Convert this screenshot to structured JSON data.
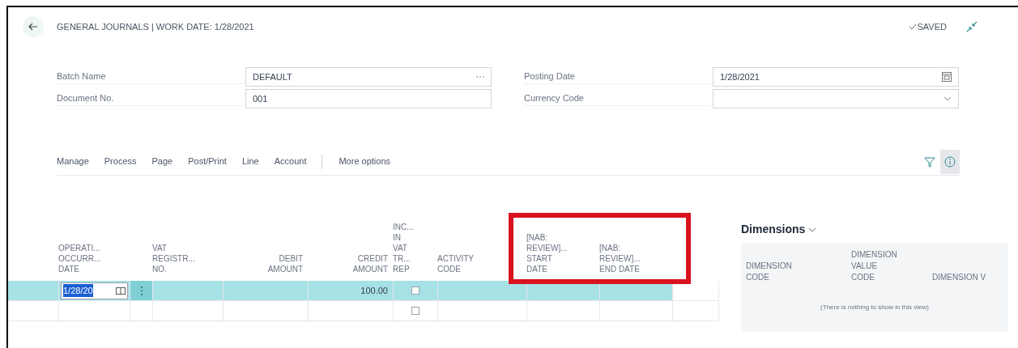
{
  "header": {
    "title": "GENERAL JOURNALS | WORK DATE: 1/28/2021",
    "status": "SAVED"
  },
  "fields": [
    {
      "label": "Batch Name",
      "value": "DEFAULT",
      "kind": "lookup"
    },
    {
      "label": "Posting Date",
      "value": "1/28/2021",
      "kind": "date"
    },
    {
      "label": "Document No.",
      "value": "001",
      "kind": "text"
    },
    {
      "label": "Currency Code",
      "kind": "dropdown"
    }
  ],
  "actions": [
    "Manage",
    "Process",
    "Page",
    "Post/Print",
    "Line",
    "Account"
  ],
  "more_options": "More options",
  "columns": [
    {
      "label": "OPERATI... OCCURR... DATE",
      "kind": "text"
    },
    {
      "label": "VAT REGISTR... NO.",
      "kind": "text"
    },
    {
      "label": "DEBIT AMOUNT",
      "kind": "amount"
    },
    {
      "label": "CREDIT AMOUNT",
      "kind": "amount"
    },
    {
      "label": "INC... IN VAT TR... REP",
      "kind": "text"
    },
    {
      "label": "ACTIVITY CODE",
      "kind": "text"
    },
    {
      "label": "[NAB: REVIEW]... START DATE",
      "kind": "text"
    },
    {
      "label": "[NAB: REVIEW]... END DATE",
      "kind": "text"
    }
  ],
  "rows": [
    {
      "selected": true,
      "operation_date": "1/28/20",
      "credit_amount": "100.00",
      "inc_in_vat": {
        "checked": false
      }
    },
    {
      "selected": false,
      "inc_in_vat": {
        "checked": false
      }
    }
  ],
  "dimensions": {
    "title": "Dimensions",
    "columns": [
      "DIMENSION CODE",
      "DIMENSION VALUE CODE",
      "DIMENSION V"
    ],
    "empty_text": "(There is nothing to show in this view)"
  }
}
